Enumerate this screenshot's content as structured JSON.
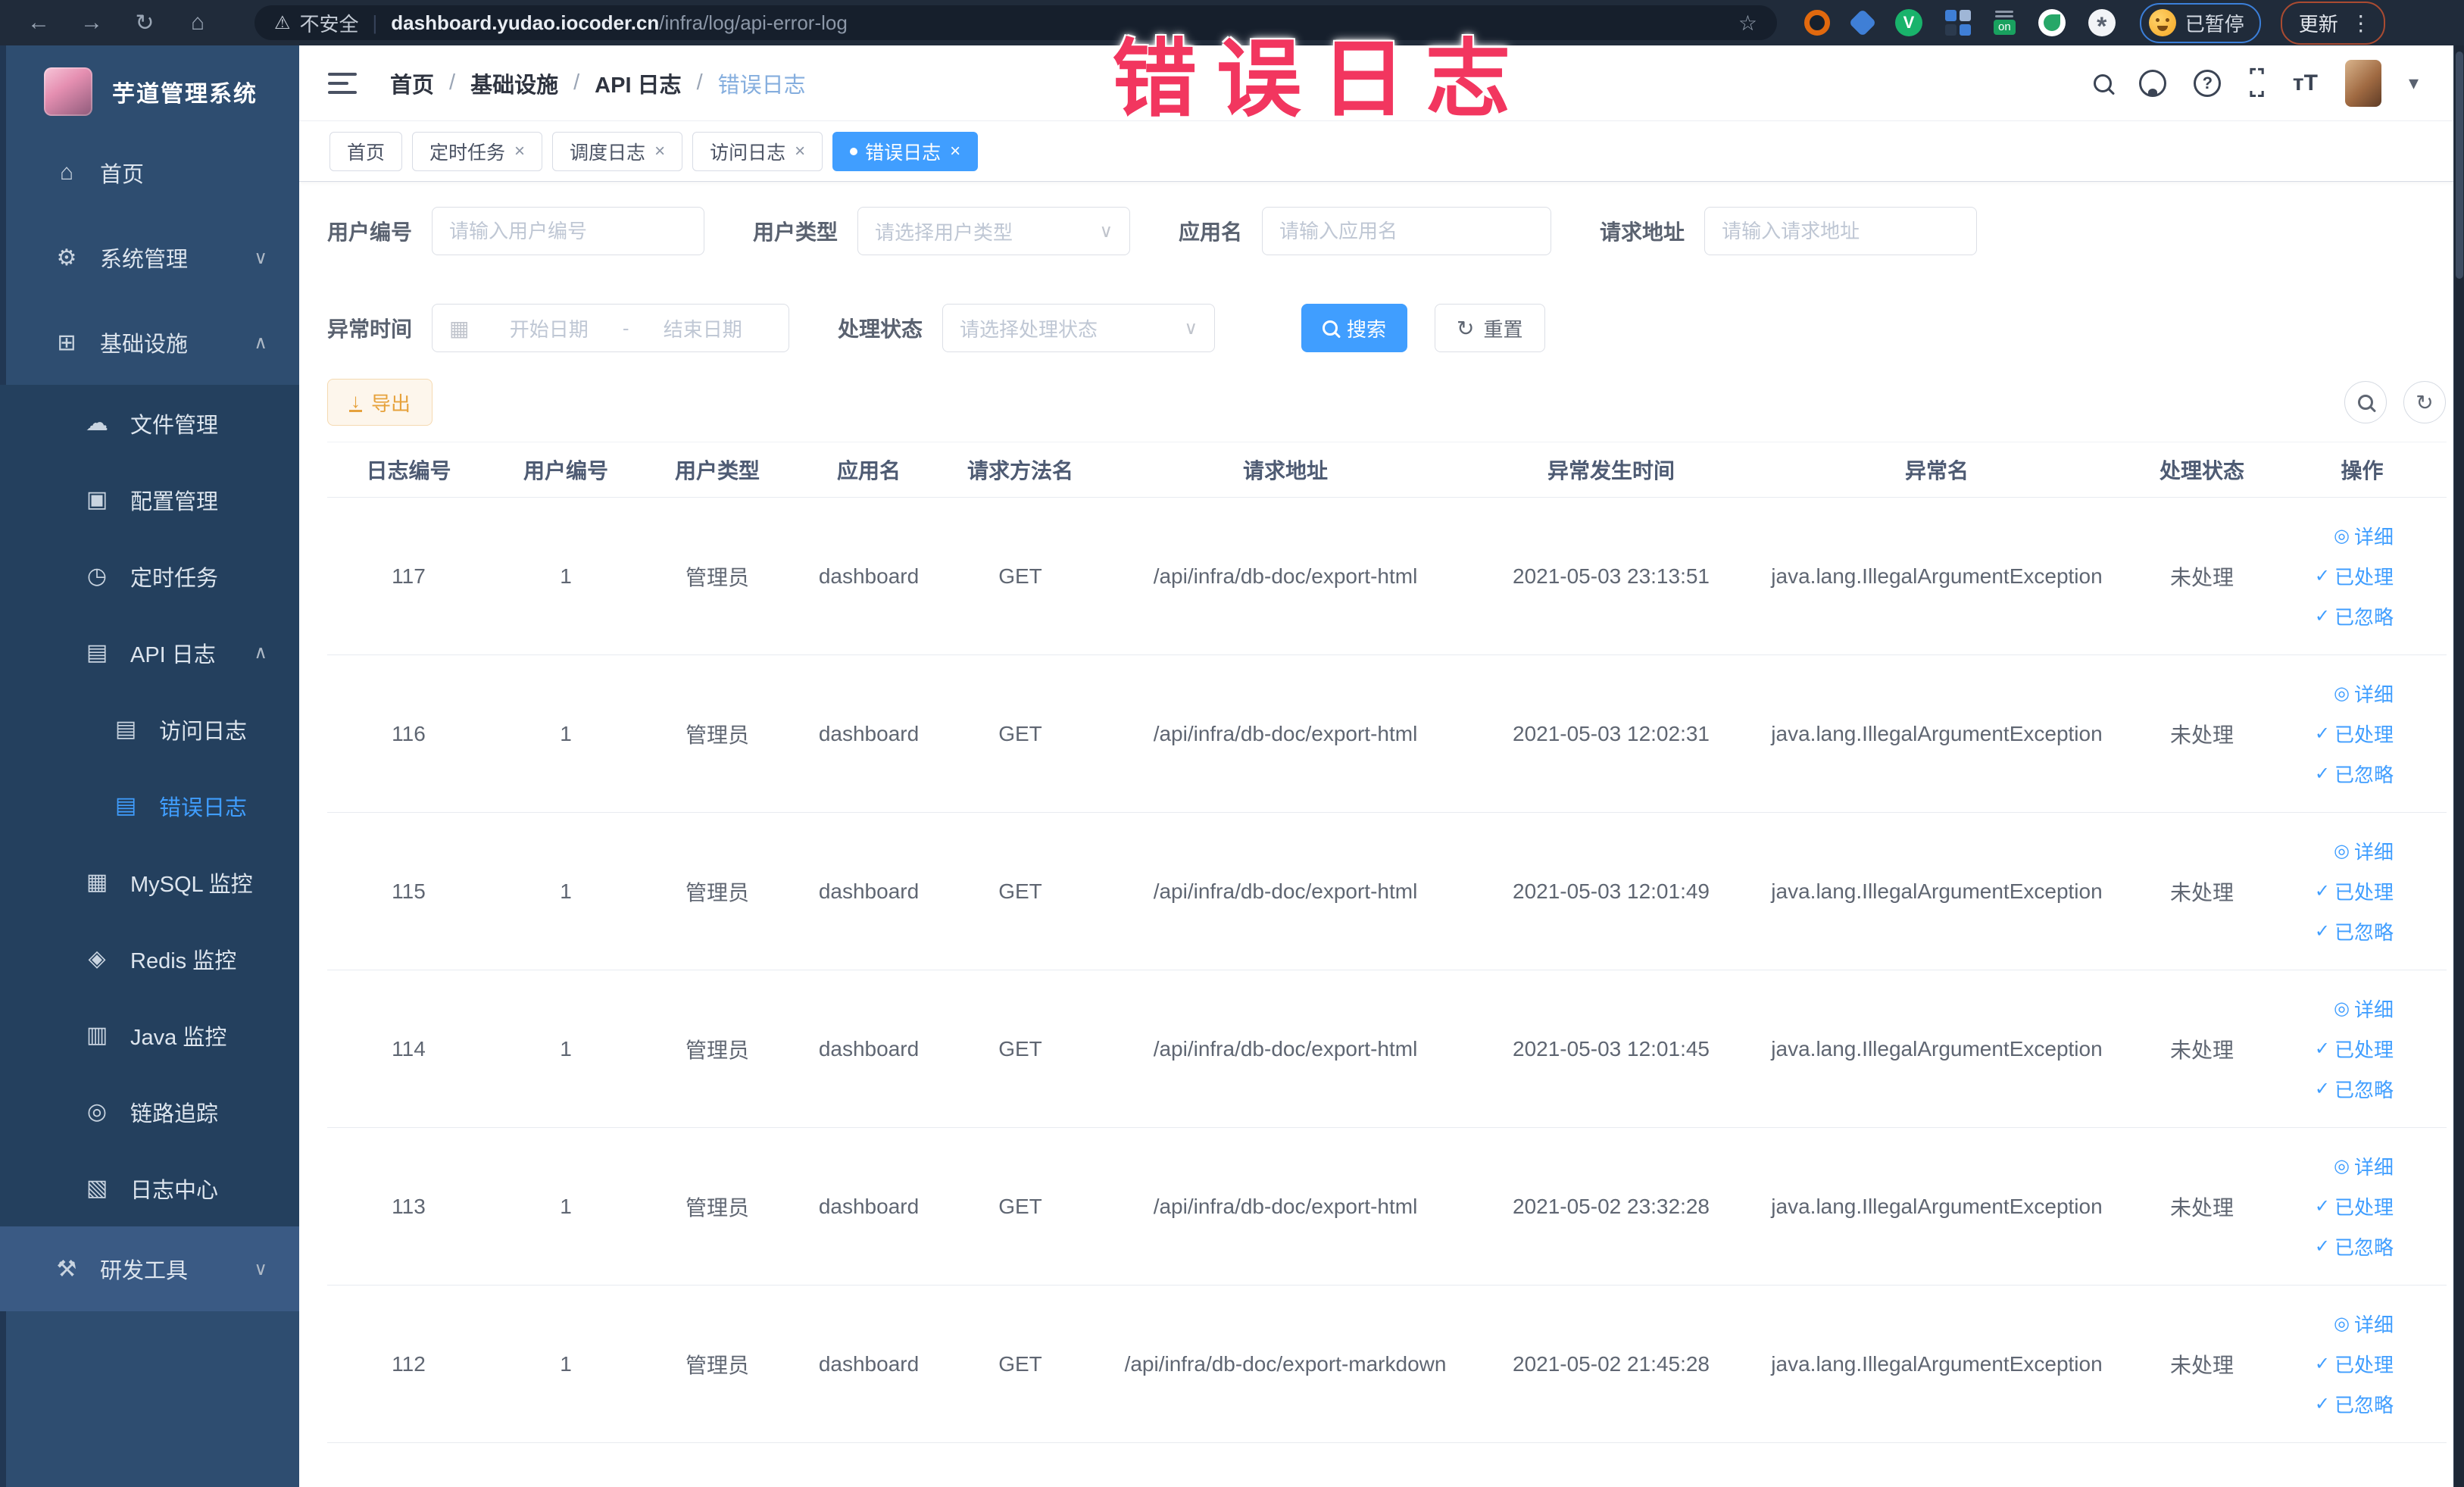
{
  "colors": {
    "accent": "#409eff",
    "warning_button": "#e6a23c",
    "watermark": "#f2365f",
    "active_tab_bg": "#409eff"
  },
  "watermark": "错误日志",
  "icons": {
    "back": "←",
    "forward": "→",
    "reload": "↻",
    "home": "⌂",
    "warning": "⚠",
    "star": "☆",
    "kebab": "⋮",
    "caret_down": "▾",
    "url_divider": "|",
    "vue_badge": "V",
    "on_badge": "on",
    "pinwheel": "*",
    "help": "?",
    "fontsize": "ᴛT",
    "corners_top": "⌜⌝",
    "corners_bottom": "⌞⌟",
    "chevron_down": "∨",
    "chevron_up": "∧",
    "close": "×",
    "calendar": "▦",
    "refresh": "↻",
    "download": "↓",
    "eye": "◎",
    "check": "✓"
  },
  "browser": {
    "security_label": "不安全",
    "url_host": "dashboard.yudao.iocoder.cn",
    "url_path": "/infra/log/api-error-log",
    "paused_label": "已暂停",
    "update_label": "更新"
  },
  "sidebar": {
    "title": "芋道管理系统",
    "items": [
      {
        "label": "首页",
        "icon": "⌂",
        "chevron": "",
        "cls": "mi-row l1",
        "name": "sidebar-item-home"
      },
      {
        "label": "系统管理",
        "icon": "⚙",
        "chevron": "∨",
        "cls": "mi-row l1",
        "name": "sidebar-item-system-mgmt"
      },
      {
        "label": "基础设施",
        "icon": "⊞",
        "chevron": "∧",
        "cls": "mi-row l1",
        "name": "sidebar-item-infrastructure"
      },
      {
        "label": "文件管理",
        "icon": "☁",
        "chevron": "",
        "cls": "mi-row l2",
        "name": "sidebar-item-file-mgmt"
      },
      {
        "label": "配置管理",
        "icon": "▣",
        "chevron": "",
        "cls": "mi-row l2",
        "name": "sidebar-item-config-mgmt"
      },
      {
        "label": "定时任务",
        "icon": "◷",
        "chevron": "",
        "cls": "mi-row l2",
        "name": "sidebar-item-scheduled-jobs"
      },
      {
        "label": "API 日志",
        "icon": "▤",
        "chevron": "∧",
        "cls": "mi-row l2",
        "name": "sidebar-item-api-log"
      },
      {
        "label": "访问日志",
        "icon": "▤",
        "chevron": "",
        "cls": "mi-row l3",
        "name": "sidebar-item-access-log"
      },
      {
        "label": "错误日志",
        "icon": "▤",
        "chevron": "",
        "cls": "mi-row l3 active",
        "name": "sidebar-item-error-log"
      },
      {
        "label": "MySQL 监控",
        "icon": "▦",
        "chevron": "",
        "cls": "mi-row l2",
        "name": "sidebar-item-mysql-monitor"
      },
      {
        "label": "Redis 监控",
        "icon": "◈",
        "chevron": "",
        "cls": "mi-row l2",
        "name": "sidebar-item-redis-monitor"
      },
      {
        "label": "Java 监控",
        "icon": "▥",
        "chevron": "",
        "cls": "mi-row l2",
        "name": "sidebar-item-java-monitor"
      },
      {
        "label": "链路追踪",
        "icon": "◎",
        "chevron": "",
        "cls": "mi-row l2",
        "name": "sidebar-item-tracing"
      },
      {
        "label": "日志中心",
        "icon": "▧",
        "chevron": "",
        "cls": "mi-row l2",
        "name": "sidebar-item-log-center"
      },
      {
        "label": "研发工具",
        "icon": "⚒",
        "chevron": "∨",
        "cls": "mi-row l1 dev",
        "name": "sidebar-item-dev-tools"
      }
    ]
  },
  "navbar": {
    "separator": "/",
    "breadcrumb": [
      "首页",
      "基础设施",
      "API 日志",
      "错误日志"
    ]
  },
  "tabs": [
    {
      "label": "首页"
    },
    {
      "label": "定时任务"
    },
    {
      "label": "调度日志"
    },
    {
      "label": "访问日志"
    },
    {
      "label": "错误日志"
    }
  ],
  "filters": {
    "user_id": {
      "label": "用户编号",
      "placeholder": "请输入用户编号"
    },
    "user_type": {
      "label": "用户类型",
      "placeholder": "请选择用户类型"
    },
    "app_name": {
      "label": "应用名",
      "placeholder": "请输入应用名"
    },
    "req_url": {
      "label": "请求地址",
      "placeholder": "请输入请求地址"
    },
    "time": {
      "label": "异常时间",
      "start_placeholder": "开始日期",
      "separator": "-",
      "end_placeholder": "结束日期"
    },
    "status": {
      "label": "处理状态",
      "placeholder": "请选择处理状态"
    },
    "search_label": "搜索",
    "reset_label": "重置"
  },
  "toolbar": {
    "export_label": "导出"
  },
  "table": {
    "headers": [
      {
        "label": "日志编号"
      },
      {
        "label": "用户编号"
      },
      {
        "label": "用户类型"
      },
      {
        "label": "应用名"
      },
      {
        "label": "请求方法名"
      },
      {
        "label": "请求地址"
      },
      {
        "label": "异常发生时间"
      },
      {
        "label": "异常名"
      },
      {
        "label": "处理状态"
      },
      {
        "label": "操作"
      }
    ],
    "actions": [
      {
        "label": "详细"
      },
      {
        "label": "已处理"
      },
      {
        "label": "已忽略"
      }
    ],
    "rows": [
      {
        "id": "117",
        "user_id": "1",
        "user_type": "管理员",
        "app": "dashboard",
        "method": "GET",
        "url": "/api/infra/db-doc/export-html",
        "time": "2021-05-03 23:13:51",
        "exception": "java.lang.IllegalArgumentException",
        "status": "未处理"
      },
      {
        "id": "116",
        "user_id": "1",
        "user_type": "管理员",
        "app": "dashboard",
        "method": "GET",
        "url": "/api/infra/db-doc/export-html",
        "time": "2021-05-03 12:02:31",
        "exception": "java.lang.IllegalArgumentException",
        "status": "未处理"
      },
      {
        "id": "115",
        "user_id": "1",
        "user_type": "管理员",
        "app": "dashboard",
        "method": "GET",
        "url": "/api/infra/db-doc/export-html",
        "time": "2021-05-03 12:01:49",
        "exception": "java.lang.IllegalArgumentException",
        "status": "未处理"
      },
      {
        "id": "114",
        "user_id": "1",
        "user_type": "管理员",
        "app": "dashboard",
        "method": "GET",
        "url": "/api/infra/db-doc/export-html",
        "time": "2021-05-03 12:01:45",
        "exception": "java.lang.IllegalArgumentException",
        "status": "未处理"
      },
      {
        "id": "113",
        "user_id": "1",
        "user_type": "管理员",
        "app": "dashboard",
        "method": "GET",
        "url": "/api/infra/db-doc/export-html",
        "time": "2021-05-02 23:32:28",
        "exception": "java.lang.IllegalArgumentException",
        "status": "未处理"
      },
      {
        "id": "112",
        "user_id": "1",
        "user_type": "管理员",
        "app": "dashboard",
        "method": "GET",
        "url": "/api/infra/db-doc/export-markdown",
        "time": "2021-05-02 21:45:28",
        "exception": "java.lang.IllegalArgumentException",
        "status": "未处理"
      }
    ]
  }
}
